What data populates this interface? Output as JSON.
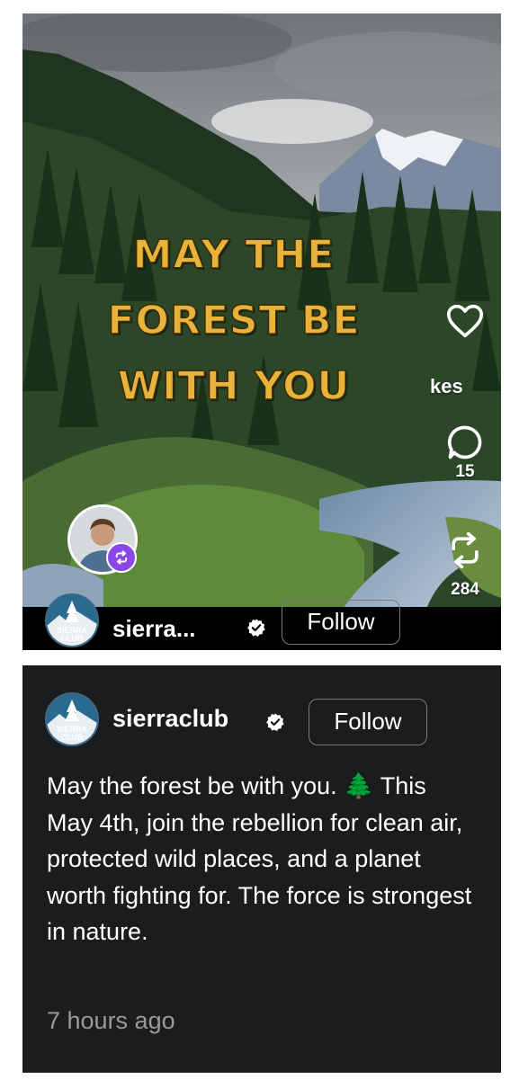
{
  "reel": {
    "headline_lines": [
      "MAY THE",
      "FOREST BE",
      "WITH YOU"
    ],
    "likes_label": "kes",
    "comments_count": "15",
    "reposts_count": "284",
    "username_truncated": "sierra...",
    "follow_label": "Follow",
    "logo_text": [
      "SIERRA",
      "CLUB"
    ]
  },
  "post": {
    "username": "sierraclub",
    "follow_label": "Follow",
    "caption": "May the forest be with you. 🌲 This May 4th, join the rebellion for clean air, protected wild places, and a planet worth fighting for. The force is strongest in nature.",
    "timestamp": "7 hours ago",
    "logo_text": [
      "SIERRA",
      "CLUB"
    ]
  },
  "icons": [
    "heart-icon",
    "comment-icon",
    "repost-icon",
    "verified-badge-icon",
    "remix-icon"
  ],
  "colors": {
    "headline": "#e8b33a",
    "remix_badge": "#8a46e8",
    "card_bg": "#1b1c1e"
  }
}
